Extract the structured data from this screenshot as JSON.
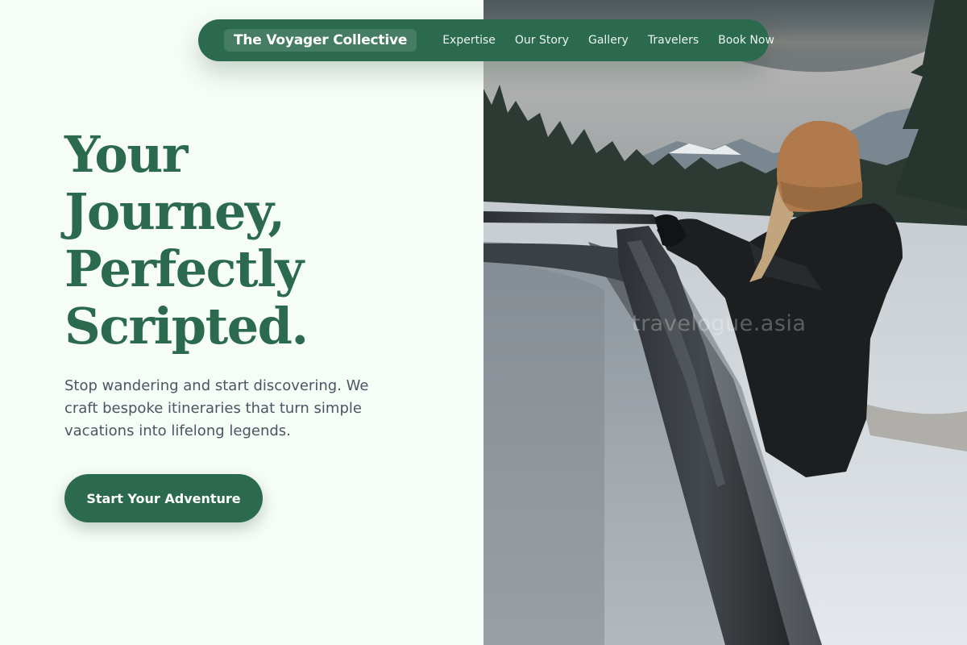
{
  "nav": {
    "brand": "The Voyager Collective",
    "links": [
      "Expertise",
      "Our Story",
      "Gallery",
      "Travelers",
      "Book Now"
    ]
  },
  "hero": {
    "headline_lines": [
      "Your",
      "Journey,",
      "Perfectly",
      "Scripted."
    ],
    "subtext": "Stop wandering and start discovering. We craft bespoke itineraries that turn simple vacations into lifelong legends.",
    "cta_label": "Start Your Adventure",
    "image_alt": "Traveler in a beanie leaning out of a car roof in a snowy forest",
    "watermark": "travelogue.asia"
  },
  "colors": {
    "brand_green": "#2b6a4f",
    "background": "#f6fdf6",
    "body_text": "#4b5563"
  }
}
